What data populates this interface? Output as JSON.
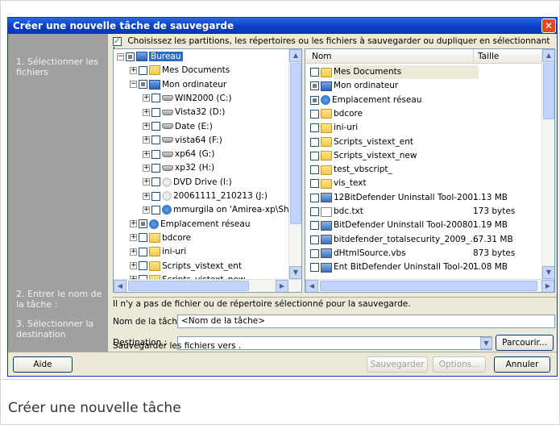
{
  "window": {
    "title": "Créer une nouvelle tâche de sauvegarde",
    "close_label": "✕"
  },
  "sidebar": {
    "step1": "1. Sélectionner les fichiers",
    "step2": "2. Entrer le nom de la tâche :",
    "step3": "3. Sélectionner la destination"
  },
  "header": {
    "instruction": "Choisissez les partitions, les répertoires ou les fichiers à sauvegarder ou dupliquer en sélectionnant leurs cases",
    "checked": true
  },
  "tree": {
    "items": [
      {
        "label": "Bureau",
        "icon": "desktop-icon",
        "level": 0
      },
      {
        "label": "Mes Documents",
        "icon": "folder-icon",
        "level": 1
      },
      {
        "label": "Mon ordinateur",
        "icon": "computer-icon",
        "level": 1
      },
      {
        "label": "WIN2000 (C:)",
        "icon": "drive-icon",
        "level": 2
      },
      {
        "label": "Vista32 (D:)",
        "icon": "drive-icon",
        "level": 2
      },
      {
        "label": "Date (E:)",
        "icon": "drive-icon",
        "level": 2
      },
      {
        "label": "vista64 (F:)",
        "icon": "drive-icon",
        "level": 2
      },
      {
        "label": "xp64 (G:)",
        "icon": "drive-icon",
        "level": 2
      },
      {
        "label": "xp32 (H:)",
        "icon": "drive-icon",
        "level": 2
      },
      {
        "label": "DVD Drive (I:)",
        "icon": "cd-icon",
        "level": 2
      },
      {
        "label": "20061111_210213 (J:)",
        "icon": "cd-icon",
        "level": 2
      },
      {
        "label": "mmurgila on 'Amirea-xp\\Share",
        "icon": "network-drive-icon",
        "level": 2
      },
      {
        "label": "Emplacement réseau",
        "icon": "network-icon",
        "level": 1
      },
      {
        "label": "bdcore",
        "icon": "folder-icon",
        "level": 1
      },
      {
        "label": "ini-uri",
        "icon": "folder-icon",
        "level": 1
      },
      {
        "label": "Scripts_vistext_ent",
        "icon": "folder-icon",
        "level": 1
      },
      {
        "label": "Scripts_vistext_new",
        "icon": "folder-icon",
        "level": 1
      }
    ]
  },
  "list": {
    "col_name": "Nom",
    "col_size": "Taille",
    "rows": [
      {
        "name": "Mes Documents",
        "size": "",
        "icon": "folder-icon"
      },
      {
        "name": "Mon ordinateur",
        "size": "",
        "icon": "computer-icon"
      },
      {
        "name": "Emplacement réseau",
        "size": "",
        "icon": "network-icon"
      },
      {
        "name": "bdcore",
        "size": "",
        "icon": "folder-icon"
      },
      {
        "name": "ini-uri",
        "size": "",
        "icon": "folder-icon"
      },
      {
        "name": "Scripts_vistext_ent",
        "size": "",
        "icon": "folder-icon"
      },
      {
        "name": "Scripts_vistext_new",
        "size": "",
        "icon": "folder-icon"
      },
      {
        "name": "test_vbscript_",
        "size": "",
        "icon": "folder-icon"
      },
      {
        "name": "vis_text",
        "size": "",
        "icon": "folder-icon"
      },
      {
        "name": "12BitDefender Uninstall Tool-200...",
        "size": "1.13 MB",
        "icon": "exe-icon"
      },
      {
        "name": "bdc.txt",
        "size": "173 bytes",
        "icon": "text-file-icon"
      },
      {
        "name": "BitDefender Uninstall Tool-20080...",
        "size": "1.19 MB",
        "icon": "exe-icon"
      },
      {
        "name": "bitdefender_totalsecurity_2009_...",
        "size": "67.31 MB",
        "icon": "exe-icon"
      },
      {
        "name": "dHtmlSource.vbs",
        "size": "873 bytes",
        "icon": "script-icon"
      },
      {
        "name": "Ent BitDefender Uninstall Tool-20...",
        "size": "1.08 MB",
        "icon": "exe-icon"
      }
    ]
  },
  "status_message": "Il n'y a pas de fichier ou de répertoire sélectionné pour la sauvegarde.",
  "task_name": {
    "label": "Nom de la tâche",
    "value": "<Nom de la tâche>"
  },
  "destination": {
    "label": "Destination :",
    "value": "",
    "browse_label": "Parcourir...",
    "save_to_text": "Sauvegarder les fichiers vers ."
  },
  "buttons": {
    "help": "Aide",
    "save": "Sauvegarder",
    "options": "Options...",
    "cancel": "Annuler"
  },
  "caption": "Créer une nouvelle tâche"
}
